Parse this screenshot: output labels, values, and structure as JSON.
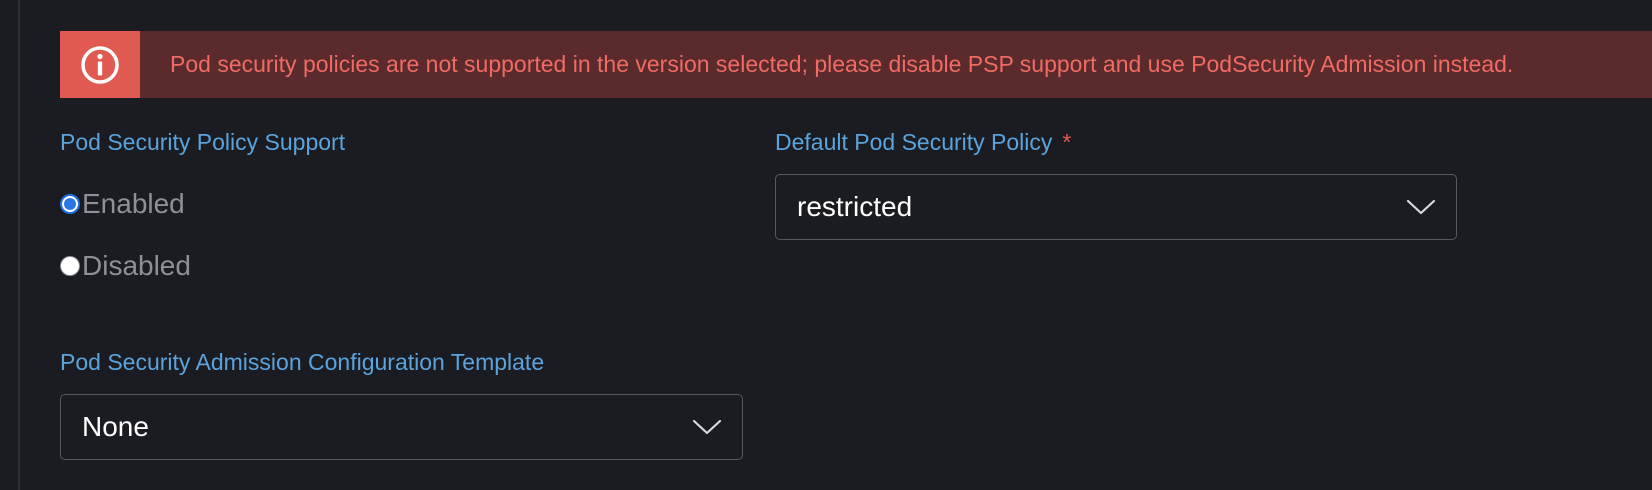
{
  "banner": {
    "message": "Pod security policies are not supported in the version selected; please disable PSP support and use PodSecurity Admission instead.",
    "icon": "info-circle-icon",
    "accent_color": "#e05a52",
    "background_color": "#5a2a2d",
    "text_color": "#f06b63"
  },
  "psp_support": {
    "label": "Pod Security Policy Support",
    "options": [
      {
        "label": "Enabled",
        "selected": true
      },
      {
        "label": "Disabled",
        "selected": false
      }
    ]
  },
  "default_psp": {
    "label": "Default Pod Security Policy",
    "required_mark": "*",
    "value": "restricted",
    "icon": "chevron-down-icon"
  },
  "psa_template": {
    "label": "Pod Security Admission Configuration Template",
    "value": "None",
    "icon": "chevron-down-icon"
  },
  "colors": {
    "background": "#1b1c21",
    "label": "#5aa3dd",
    "required": "#e55a4f",
    "radio_selected": "#2b78e4"
  }
}
